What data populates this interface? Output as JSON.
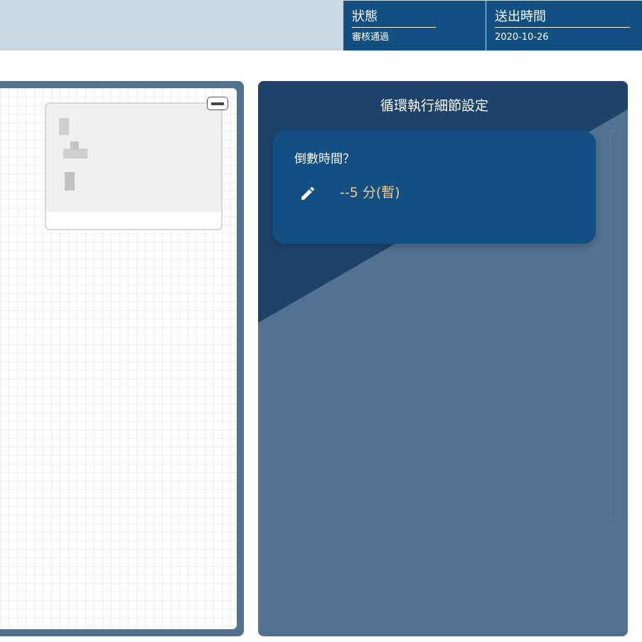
{
  "header": {
    "status_label": "狀態",
    "status_value": "審核通過",
    "sent_time_label": "送出時間",
    "sent_time_value": "2020-10-26"
  },
  "canvas": {
    "minimap_toggle_icon": "minus-icon"
  },
  "settings": {
    "title": "循環執行細節設定",
    "question": "倒數時間？",
    "edit_icon": "pencil-icon",
    "countdown_value": "--5 分(暫)"
  },
  "colors": {
    "header_bg": "#c8d9e8",
    "primary": "#134f80",
    "panel": "#52728f",
    "panel_dark": "#1f426c",
    "value_text": "#f3c98b"
  }
}
